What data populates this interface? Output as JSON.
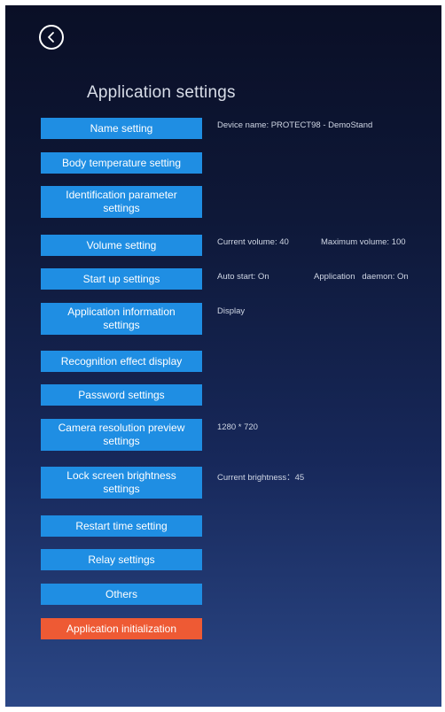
{
  "page": {
    "title": "Application settings"
  },
  "buttons": {
    "name": "Name setting",
    "body_temp": "Body temperature setting",
    "identification": "Identification parameter settings",
    "volume": "Volume setting",
    "startup": "Start up settings",
    "app_info": "Application information settings",
    "recognition": "Recognition effect display",
    "password": "Password settings",
    "camera": "Camera resolution preview settings",
    "lock_brightness": "Lock screen brightness settings",
    "restart": "Restart time setting",
    "relay": "Relay settings",
    "others": "Others",
    "initialization": "Application initialization"
  },
  "info": {
    "device_name": "Device name: PROTECT98 - DemoStand",
    "current_volume": "Current volume: 40",
    "maximum_volume": "Maximum volume: 100",
    "auto_start": "Auto start: On",
    "app_daemon": "Application   daemon: On",
    "app_info_display": "Display",
    "camera_resolution": "1280 * 720",
    "current_brightness": "Current brightness：45"
  },
  "colors": {
    "button": "#1f8ee3",
    "danger_button": "#ee5a34",
    "background_top": "#0a0f26",
    "background_bottom": "#2b4786"
  },
  "icons": {
    "back": "chevron-left-circle-icon"
  }
}
